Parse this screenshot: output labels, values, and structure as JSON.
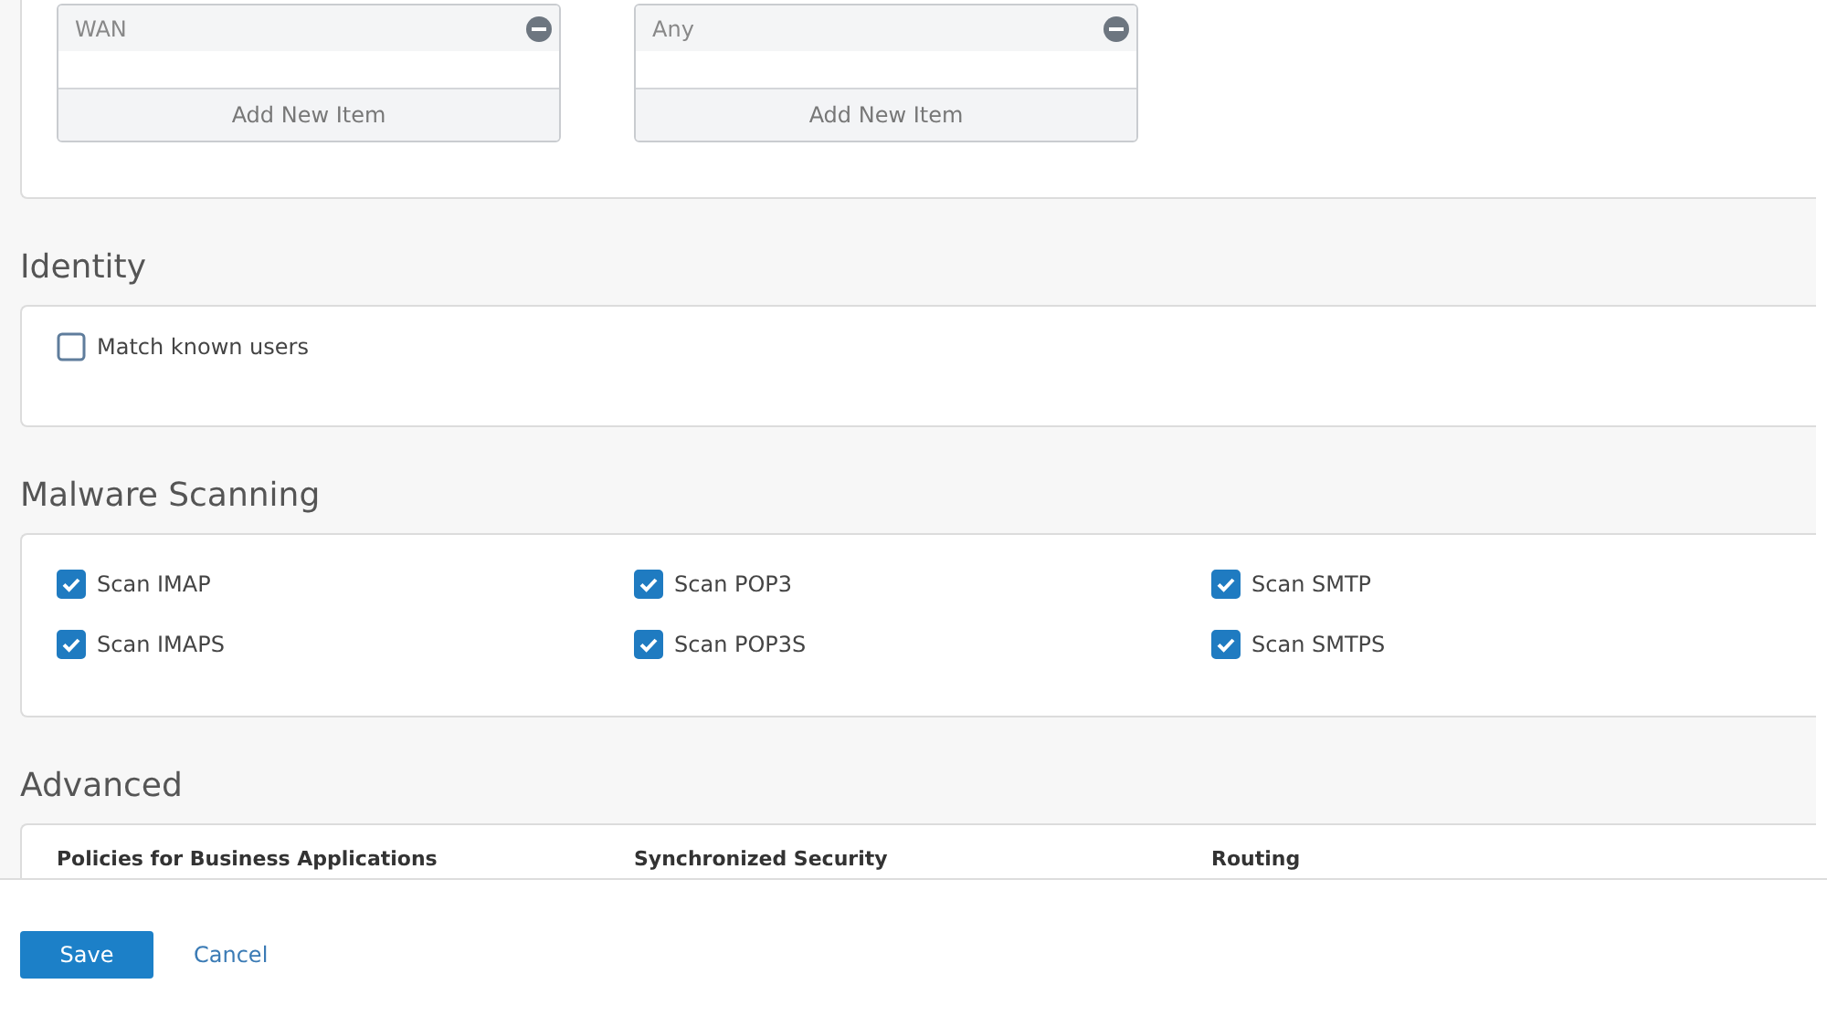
{
  "lists": [
    {
      "item": "WAN",
      "add_label": "Add New Item"
    },
    {
      "item": "Any",
      "add_label": "Add New Item"
    }
  ],
  "sections": [
    {
      "title": "Identity",
      "kind": "checks",
      "checks": [
        {
          "label": "Match known users",
          "checked": false
        }
      ]
    },
    {
      "title": "Malware Scanning",
      "kind": "checks",
      "checks": [
        {
          "label": "Scan IMAP",
          "checked": true
        },
        {
          "label": "Scan POP3",
          "checked": true
        },
        {
          "label": "Scan SMTP",
          "checked": true
        },
        {
          "label": "Scan IMAPS",
          "checked": true
        },
        {
          "label": "Scan POP3S",
          "checked": true
        },
        {
          "label": "Scan SMTPS",
          "checked": true
        }
      ]
    },
    {
      "title": "Advanced",
      "kind": "headings",
      "headings": [
        "Policies for Business Applications",
        "Synchronized Security",
        "Routing"
      ]
    }
  ],
  "footer": {
    "save": "Save",
    "cancel": "Cancel"
  }
}
